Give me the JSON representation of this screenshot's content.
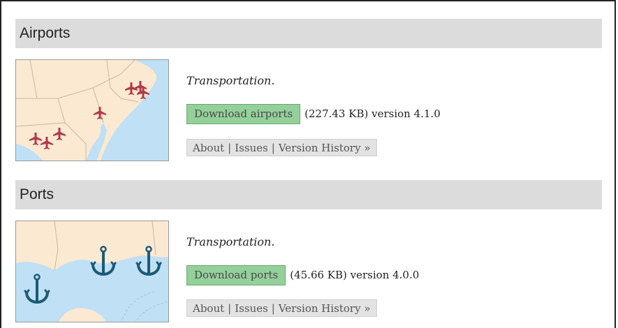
{
  "sections": [
    {
      "title": "Airports",
      "description": "Transportation.",
      "download_label": "Download airports",
      "meta": "(227.43 KB) version 4.1.0",
      "links": {
        "about": "About",
        "issues": "Issues",
        "history": "Version History »",
        "separator": "|"
      },
      "thumbnail_icon": "airplane-icon"
    },
    {
      "title": "Ports",
      "description": "Transportation.",
      "download_label": "Download ports",
      "meta": "(45.66 KB) version 4.0.0",
      "links": {
        "about": "About",
        "issues": "Issues",
        "history": "Version History »",
        "separator": "|"
      },
      "thumbnail_icon": "anchor-icon"
    }
  ],
  "colors": {
    "header_bg": "#dcdcdc",
    "download_bg": "#94d09a",
    "links_bg": "#e3e3e3",
    "airplane": "#b03a4a",
    "anchor": "#1d5a78",
    "land": "#fbe9d2",
    "water": "#bfe0f5"
  }
}
